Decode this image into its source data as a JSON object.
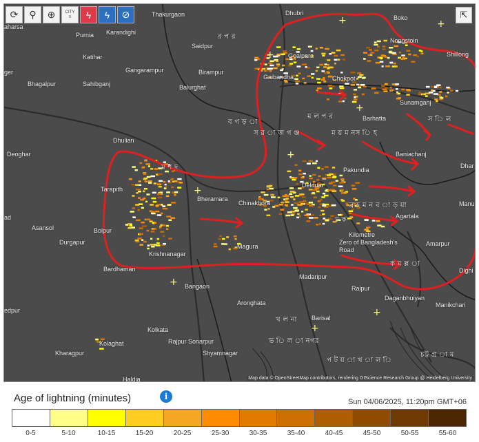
{
  "toolbar": {
    "refresh_icon": "⟳",
    "locate_icon": "⚲",
    "zoom_icon": "⊕",
    "city_label": "CITY",
    "strike_icon": "ϟ",
    "sound_icon": "ϟ",
    "satellite_icon": "⊘",
    "share_icon": "⇱"
  },
  "map": {
    "attribution": "Map data © OpenStreetMap contributors, rendering GIScience Research Group @ Heidelberg University",
    "places": [
      {
        "text": "Thakurgaon",
        "cls": ""
      },
      {
        "text": "Dhubri",
        "cls": ""
      },
      {
        "text": "Boko",
        "cls": ""
      },
      {
        "text": "aharsa",
        "cls": ""
      },
      {
        "text": "Purnia",
        "cls": ""
      },
      {
        "text": "Karandighi",
        "cls": ""
      },
      {
        "text": "র  প র",
        "cls": "lg"
      },
      {
        "text": "Saidpur",
        "cls": ""
      },
      {
        "text": "Katihar",
        "cls": ""
      },
      {
        "text": "Goalpara",
        "cls": ""
      },
      {
        "text": "Shillong",
        "cls": ""
      },
      {
        "text": "ger",
        "cls": ""
      },
      {
        "text": "Gangarampur",
        "cls": ""
      },
      {
        "text": "Birampur",
        "cls": ""
      },
      {
        "text": "Gaibandha",
        "cls": ""
      },
      {
        "text": "Nongstoin",
        "cls": ""
      },
      {
        "text": "Bhagalpur",
        "cls": ""
      },
      {
        "text": "Sahibganj",
        "cls": ""
      },
      {
        "text": "Balurghat",
        "cls": ""
      },
      {
        "text": "Chokpot",
        "cls": ""
      },
      {
        "text": "Sunamganj",
        "cls": ""
      },
      {
        "text": "Barhatta",
        "cls": ""
      },
      {
        "text": "ম  ল প  র",
        "cls": "lg"
      },
      {
        "text": "ব গ  ড় া",
        "cls": "lg"
      },
      {
        "text": "স র া জ গ ঞ্জ",
        "cls": "lg"
      },
      {
        "text": "ম য় ম নস ি  হ",
        "cls": "lg"
      },
      {
        "text": "স  ি ল",
        "cls": "lg"
      },
      {
        "text": "Dhulian",
        "cls": ""
      },
      {
        "text": "Deoghar",
        "cls": ""
      },
      {
        "text": "Baniachanj",
        "cls": ""
      },
      {
        "text": "ম শ  দ",
        "cls": "lg"
      },
      {
        "text": "Dhar",
        "cls": ""
      },
      {
        "text": "Pakundia",
        "cls": ""
      },
      {
        "text": "Tarapith",
        "cls": ""
      },
      {
        "text": "Bheramara",
        "cls": ""
      },
      {
        "text": "Delduar",
        "cls": ""
      },
      {
        "text": "Chinakhora",
        "cls": ""
      },
      {
        "text": "ব্র হ ম ন ব া ড় য়া",
        "cls": "lg"
      },
      {
        "text": "Manu",
        "cls": ""
      },
      {
        "text": "ad",
        "cls": ""
      },
      {
        "text": "Asansol",
        "cls": ""
      },
      {
        "text": "Bolpur",
        "cls": ""
      },
      {
        "text": "Agartala",
        "cls": ""
      },
      {
        "text": "ঢ  ক",
        "cls": "lg"
      },
      {
        "text": "Durgapur",
        "cls": ""
      },
      {
        "text": "Magura",
        "cls": ""
      },
      {
        "text": "Kilometre",
        "cls": ""
      },
      {
        "text": "Zero of Bangladesh's",
        "cls": ""
      },
      {
        "text": "Road",
        "cls": ""
      },
      {
        "text": "Amarpur",
        "cls": ""
      },
      {
        "text": "Krishnanagar",
        "cls": ""
      },
      {
        "text": "ক  ম  ল্ল  া",
        "cls": "lg"
      },
      {
        "text": "Bardhaman",
        "cls": ""
      },
      {
        "text": "Dighi",
        "cls": ""
      },
      {
        "text": "Madaripur",
        "cls": ""
      },
      {
        "text": "Bangaon",
        "cls": ""
      },
      {
        "text": "Raipur",
        "cls": ""
      },
      {
        "text": "Daganbhuiyan",
        "cls": ""
      },
      {
        "text": "Manikchari",
        "cls": ""
      },
      {
        "text": "edpur",
        "cls": ""
      },
      {
        "text": "Aronghata",
        "cls": ""
      },
      {
        "text": "খ  ল না",
        "cls": "lg"
      },
      {
        "text": "Barisal",
        "cls": ""
      },
      {
        "text": "Kolkata",
        "cls": ""
      },
      {
        "text": "Kolaghat",
        "cls": ""
      },
      {
        "text": "Rajpur Sonarpur",
        "cls": ""
      },
      {
        "text": "ভ ি  ল া  নগর",
        "cls": "lg"
      },
      {
        "text": "Kharagpur",
        "cls": ""
      },
      {
        "text": "Shyamnagar",
        "cls": ""
      },
      {
        "text": "চট্ট গ্র া ম",
        "cls": "lg"
      },
      {
        "text": "প  ট  য় া খ া ল ি",
        "cls": "lg"
      },
      {
        "text": "Haldia",
        "cls": ""
      }
    ]
  },
  "legend": {
    "title": "Age of lightning (minutes)",
    "info_icon": "i",
    "timestamp": "Sun 04/06/2025, 11:20pm GMT+06",
    "labels": [
      "0-5",
      "5-10",
      "10-15",
      "15-20",
      "20-25",
      "25-30",
      "30-35",
      "35-40",
      "40-45",
      "45-50",
      "50-55",
      "55-60"
    ],
    "colors": [
      "#ffffff",
      "#ffff88",
      "#ffff00",
      "#ffcc22",
      "#f5a623",
      "#ff8c00",
      "#e07b00",
      "#cc6f00",
      "#b05f00",
      "#8f4c00",
      "#6e3a00",
      "#4a2700"
    ]
  }
}
